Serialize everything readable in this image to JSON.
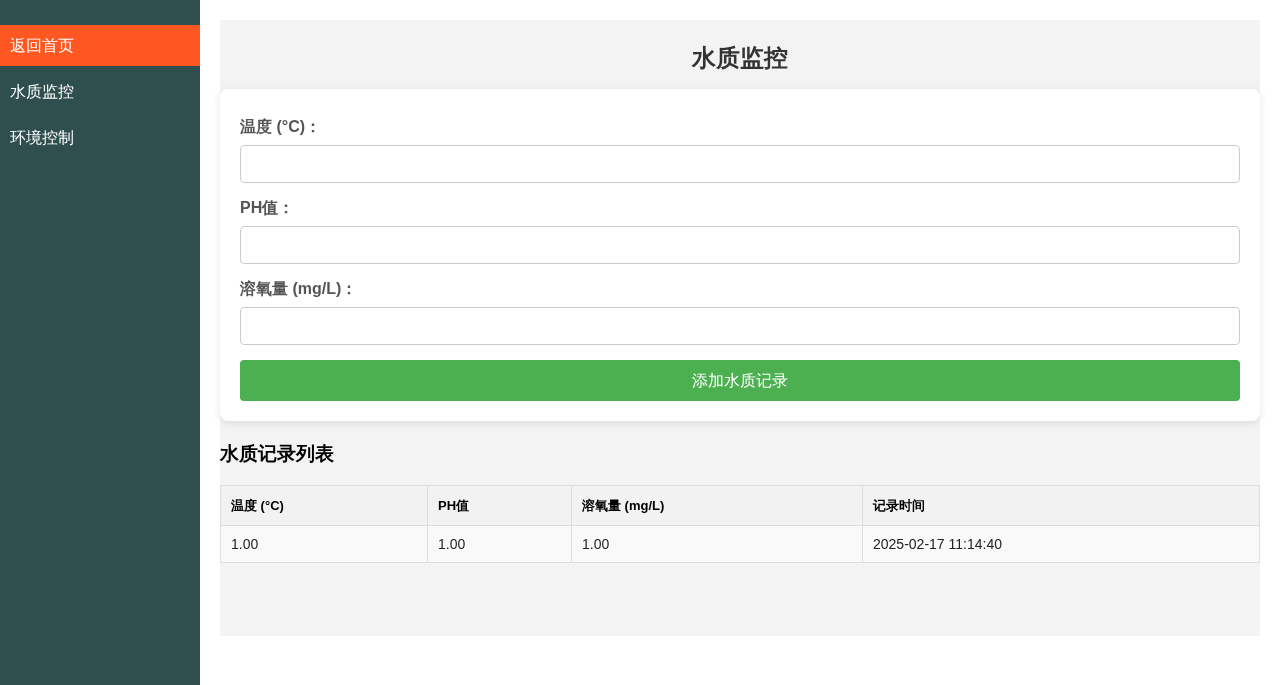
{
  "sidebar": {
    "items": [
      {
        "label": "返回首页",
        "selected": true
      },
      {
        "label": "水质监控",
        "selected": false
      },
      {
        "label": "环境控制",
        "selected": false
      }
    ]
  },
  "page_title": "水质监控",
  "form": {
    "fields": [
      {
        "label": "温度 (°C)："
      },
      {
        "label": "PH值："
      },
      {
        "label": "溶氧量 (mg/L)："
      }
    ],
    "submit_button": "添加水质记录"
  },
  "records": {
    "heading": "水质记录列表",
    "columns": [
      "温度 (°C)",
      "PH值",
      "溶氧量 (mg/L)",
      "记录时间"
    ],
    "rows": [
      [
        "1.00",
        "1.00",
        "1.00",
        "2025-02-17 11:14:40"
      ]
    ]
  }
}
